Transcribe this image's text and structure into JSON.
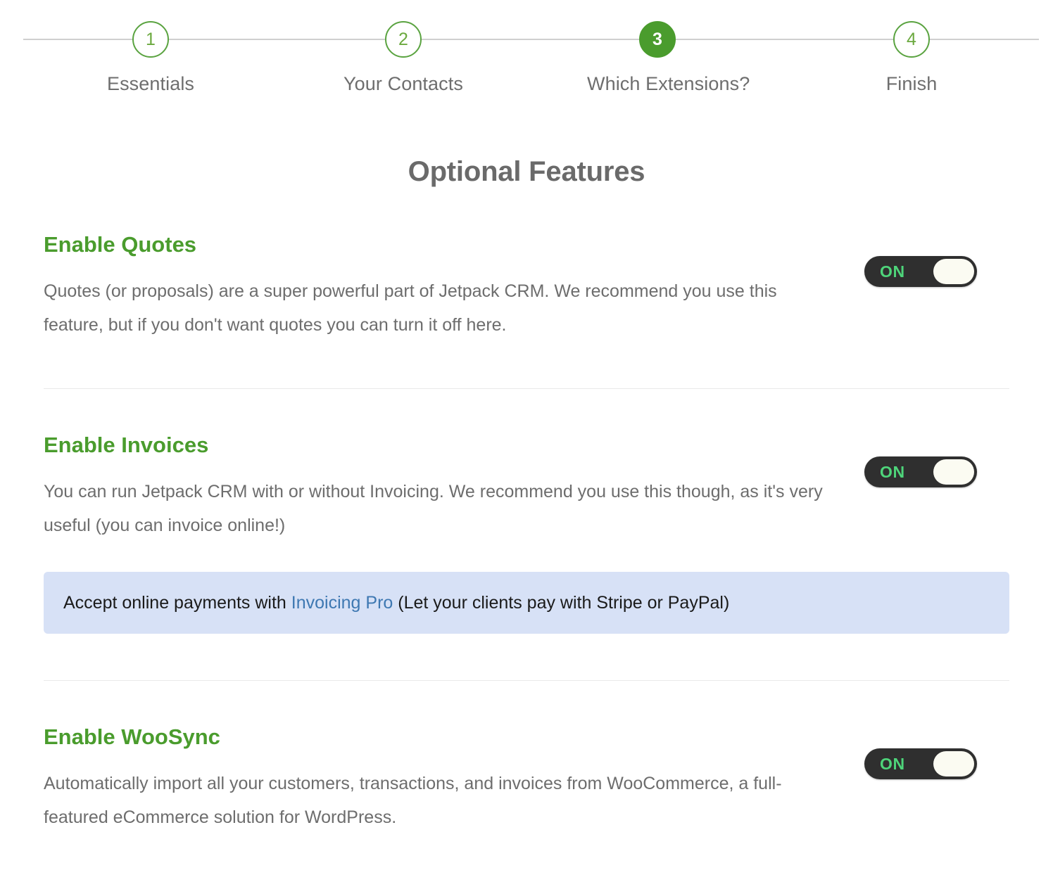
{
  "stepper": {
    "steps": [
      {
        "number": "1",
        "label": "Essentials",
        "active": false
      },
      {
        "number": "2",
        "label": "Your Contacts",
        "active": false
      },
      {
        "number": "3",
        "label": "Which Extensions?",
        "active": true
      },
      {
        "number": "4",
        "label": "Finish",
        "active": false
      }
    ]
  },
  "page": {
    "title": "Optional Features"
  },
  "features": [
    {
      "title": "Enable Quotes",
      "description": "Quotes (or proposals) are a super powerful part of Jetpack CRM. We recommend you use this feature, but if you don't want quotes you can turn it off here.",
      "toggle": {
        "state_label": "ON",
        "on": true
      }
    },
    {
      "title": "Enable Invoices",
      "description": "You can run Jetpack CRM with or without Invoicing. We recommend you use this though, as it's very useful (you can invoice online!)",
      "toggle": {
        "state_label": "ON",
        "on": true
      },
      "banner": {
        "text_before": "Accept online payments with ",
        "link_text": "Invoicing Pro",
        "text_after": " (Let your clients pay with Stripe or PayPal)"
      }
    },
    {
      "title": "Enable WooSync",
      "description": "Automatically import all your customers, transactions, and invoices from WooCommerce, a full-featured eCommerce solution for WordPress.",
      "toggle": {
        "state_label": "ON",
        "on": true
      }
    }
  ],
  "colors": {
    "accent_green": "#4a9c2d",
    "toggle_track": "#2f2f2f",
    "toggle_on_text": "#4ed47a",
    "banner_background": "#d7e1f6",
    "banner_link": "#3e78b2",
    "text_gray": "#6d6d6d",
    "divider": "#e9e9e9"
  }
}
